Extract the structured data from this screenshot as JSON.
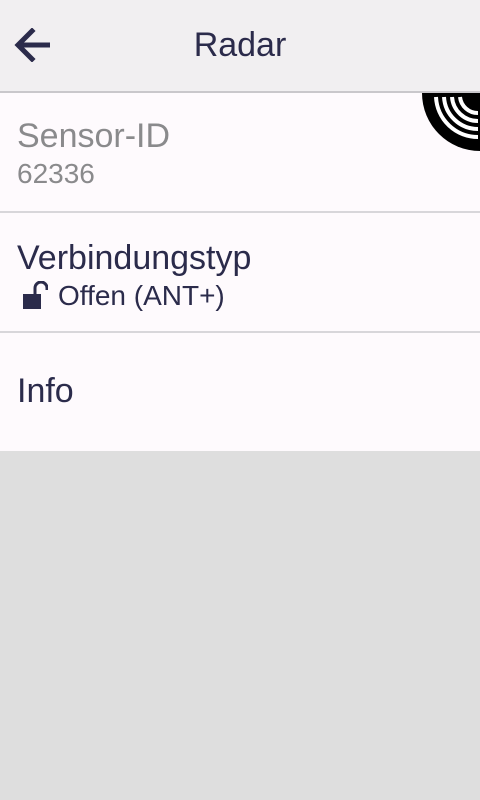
{
  "header": {
    "title": "Radar",
    "back_icon": "arrow-left-icon"
  },
  "sensor": {
    "label": "Sensor-ID",
    "value": "62336",
    "badge_icon": "radar-signal-icon"
  },
  "connection": {
    "label": "Verbindungstyp",
    "value": "Offen (ANT+)",
    "icon": "unlocked-padlock-icon"
  },
  "info": {
    "label": "Info"
  },
  "colors": {
    "header_bg": "#f1eff1",
    "list_bg": "#fefafd",
    "text": "#2b2b4b",
    "muted_text": "#8a8a8c",
    "background": "#dedede"
  }
}
